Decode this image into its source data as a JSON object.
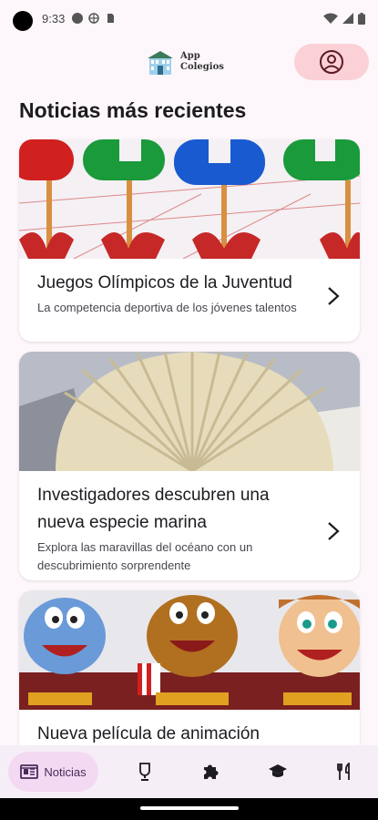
{
  "status_bar": {
    "time": "9:33"
  },
  "header": {
    "app_name_line1": "App",
    "app_name_line2": "Colegios"
  },
  "section_title": "Noticias más recientes",
  "news": [
    {
      "title": "Juegos Olímpicos de la Juventud",
      "subtitle": "La competencia deportiva de los jóvenes talentos",
      "image": "olympic-flowers-illustration"
    },
    {
      "title": "Investigadores descubren una nueva especie marina",
      "subtitle": "Explora las maravillas del océano con un descubrimiento sorprendente",
      "image": "seashell-photo"
    },
    {
      "title": "Nueva película de animación",
      "subtitle": "",
      "image": "cartoon-characters-cinema"
    }
  ],
  "bottom_nav": {
    "items": [
      {
        "label": "Noticias",
        "icon": "newspaper-icon",
        "active": true
      },
      {
        "label": "",
        "icon": "trophy-icon"
      },
      {
        "label": "",
        "icon": "puzzle-icon"
      },
      {
        "label": "",
        "icon": "graduation-cap-icon"
      },
      {
        "label": "",
        "icon": "fork-knife-icon"
      }
    ]
  },
  "colors": {
    "background": "#fdf7fb",
    "profile_button": "#fbd0d6",
    "nav_active": "#f4d9f2"
  }
}
